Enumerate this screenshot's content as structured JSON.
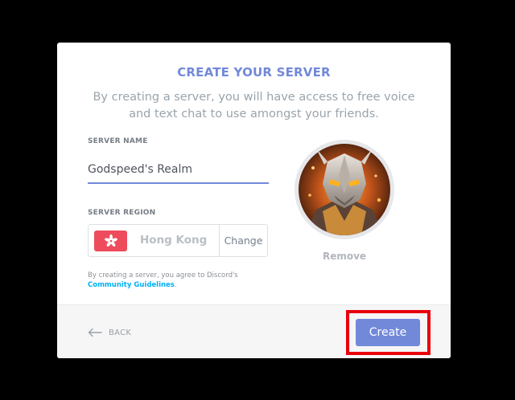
{
  "modal": {
    "title": "CREATE YOUR SERVER",
    "subtitle": "By creating a server, you will have access to free voice and text chat to use amongst your friends.",
    "accent_color": "#7289da"
  },
  "server_name": {
    "label": "SERVER NAME",
    "value": "Godspeed's Realm"
  },
  "server_region": {
    "label": "SERVER REGION",
    "region": "Hong Kong",
    "flag_icon": "hong-kong-flag-icon",
    "flag_color": "#ee4b5d",
    "change_label": "Change"
  },
  "terms": {
    "text": "By creating a server, you agree to Discord's",
    "link": "Community Guidelines",
    "suffix": "."
  },
  "avatar": {
    "icon": "server-avatar-image",
    "remove_label": "Remove"
  },
  "footer": {
    "back_icon": "arrow-left-icon",
    "back_label": "BACK",
    "create_label": "Create",
    "highlight_color": "#e8000b"
  }
}
